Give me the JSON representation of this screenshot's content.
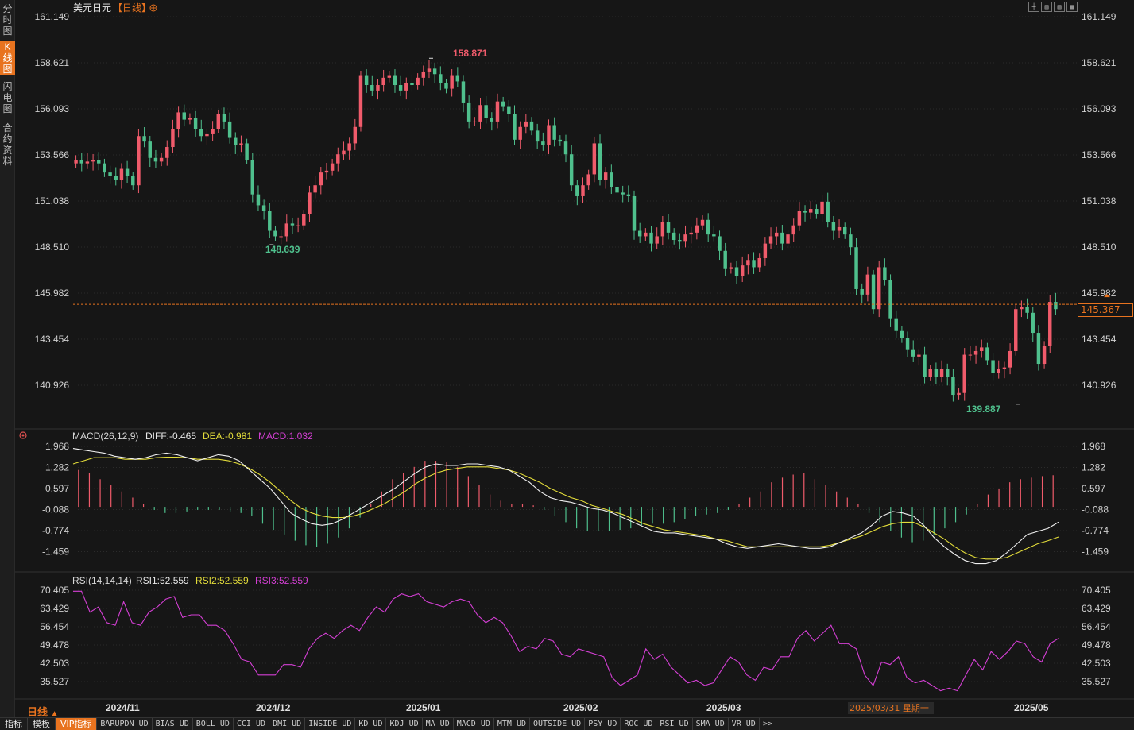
{
  "sidebar": {
    "tabs": [
      "分时图",
      "K线图",
      "闪电图",
      "合约资料"
    ],
    "active": 1
  },
  "header": {
    "symbol": "美元日元",
    "period_tag": "【日线】",
    "add_icon": "plus-circle-icon"
  },
  "toolbar": {
    "icons": [
      "crosshair-icon",
      "bar-chart-icon",
      "candle-chart-icon",
      "layout-icon"
    ]
  },
  "colors": {
    "up": "#f05b6b",
    "down": "#4fc08d",
    "accent": "#e8731f",
    "grid": "#2b2b2b",
    "diff": "#f0f0f0",
    "dea": "#e3dc3a",
    "rsi": "#d43fd4"
  },
  "price_panel": {
    "ticks": [
      "161.149",
      "158.621",
      "156.093",
      "153.566",
      "151.038",
      "148.510",
      "145.982",
      "143.454",
      "140.926"
    ],
    "current": "145.367",
    "annotations": {
      "high": "158.871",
      "low_1": "148.639",
      "low_2": "139.887"
    }
  },
  "macd_panel": {
    "label": "MACD(26,12,9)",
    "diff": "DIFF:-0.465",
    "dea": "DEA:-0.981",
    "macd": "MACD:1.032",
    "ticks": [
      "1.968",
      "1.282",
      "0.597",
      "-0.088",
      "-0.774",
      "-1.459"
    ]
  },
  "rsi_panel": {
    "label": "RSI(14,14,14)",
    "rsi1": "RSI1:52.559",
    "rsi2": "RSI2:52.559",
    "rsi3": "RSI3:52.559",
    "ticks": [
      "70.405",
      "63.429",
      "56.454",
      "49.478",
      "42.503",
      "35.527"
    ]
  },
  "x_axis": {
    "labels": [
      "2024/11",
      "2024/12",
      "2025/01",
      "2025/02",
      "2025/03",
      "2025/05"
    ]
  },
  "crosshair": {
    "date": "2025/03/31",
    "weekday": "星期一"
  },
  "period": "日线",
  "bottom_bar": {
    "tabs": [
      "指标",
      "模板"
    ],
    "vip": "VIP指标",
    "indicators": [
      "BARUPDN_UD",
      "BIAS_UD",
      "BOLL_UD",
      "CCI_UD",
      "DMI_UD",
      "INSIDE_UD",
      "KD_UD",
      "KDJ_UD",
      "MA_UD",
      "MACD_UD",
      "MTM_UD",
      "OUTSIDE_UD",
      "PSY_UD",
      "ROC_UD",
      "RSI_UD",
      "SMA_UD",
      "VR_UD"
    ],
    "more": ">>"
  },
  "chart_data": {
    "type": "candlestick",
    "title": "美元日元",
    "period": "daily",
    "x_labels": [
      "2024/11",
      "2024/12",
      "2025/01",
      "2025/02",
      "2025/03",
      "2025/05"
    ],
    "ylim": [
      139.4,
      161.149
    ],
    "current_price": 145.367,
    "high": 158.871,
    "low": 139.887,
    "closes": [
      153.3,
      153.1,
      153.2,
      153.3,
      153.1,
      152.6,
      152.4,
      152.2,
      152.8,
      152.4,
      151.9,
      154.6,
      154.3,
      153.4,
      153.2,
      153.4,
      154.0,
      155.0,
      155.9,
      155.5,
      155.6,
      155.0,
      154.6,
      154.7,
      155.0,
      155.8,
      155.4,
      154.5,
      154.1,
      154.2,
      153.3,
      151.4,
      150.8,
      150.5,
      149.4,
      149.1,
      149.1,
      149.8,
      149.7,
      149.7,
      150.3,
      151.5,
      151.9,
      152.6,
      152.7,
      153.1,
      153.6,
      153.8,
      154.2,
      155.1,
      157.9,
      157.4,
      157.1,
      157.4,
      157.8,
      157.9,
      157.4,
      157.1,
      157.5,
      157.4,
      157.8,
      158.1,
      158.3,
      158.0,
      157.5,
      157.2,
      157.9,
      157.6,
      156.4,
      155.4,
      155.4,
      156.3,
      155.6,
      155.4,
      156.5,
      156.2,
      155.8,
      154.4,
      155.1,
      155.4,
      154.9,
      154.3,
      154.1,
      155.2,
      154.4,
      154.3,
      153.6,
      151.9,
      151.3,
      151.9,
      152.5,
      154.2,
      152.2,
      152.6,
      151.8,
      151.5,
      151.4,
      151.3,
      149.4,
      149.1,
      149.3,
      148.7,
      149.1,
      149.9,
      149.3,
      148.9,
      148.8,
      149.2,
      149.3,
      149.7,
      150.0,
      149.2,
      149.1,
      148.3,
      147.3,
      147.4,
      146.9,
      147.5,
      147.8,
      147.4,
      147.9,
      148.7,
      149.1,
      149.3,
      148.7,
      149.2,
      149.7,
      150.5,
      150.4,
      150.6,
      150.3,
      151.0,
      149.9,
      149.4,
      149.6,
      149.2,
      148.5,
      146.2,
      145.9,
      147.0,
      145.1,
      147.4,
      146.7,
      144.6,
      143.9,
      143.5,
      142.9,
      142.5,
      142.6,
      141.4,
      141.8,
      141.4,
      141.8,
      141.4,
      140.4,
      140.5,
      142.6,
      142.6,
      142.8,
      143.0,
      142.3,
      141.6,
      141.8,
      141.9,
      142.8,
      145.1,
      145.2,
      144.9,
      143.8,
      142.1,
      143.1,
      145.5,
      145.1
    ],
    "series": [
      {
        "name": "DIFF",
        "values": [
          1.9,
          1.85,
          1.8,
          1.75,
          1.65,
          1.6,
          1.55,
          1.6,
          1.7,
          1.75,
          1.7,
          1.6,
          1.5,
          1.6,
          1.7,
          1.65,
          1.5,
          1.2,
          0.9,
          0.6,
          0.2,
          -0.2,
          -0.4,
          -0.55,
          -0.6,
          -0.55,
          -0.4,
          -0.2,
          0.0,
          0.2,
          0.4,
          0.6,
          0.85,
          1.1,
          1.3,
          1.4,
          1.35,
          1.35,
          1.4,
          1.4,
          1.35,
          1.3,
          1.2,
          1.0,
          0.8,
          0.5,
          0.3,
          0.2,
          0.15,
          0.05,
          -0.05,
          -0.1,
          -0.2,
          -0.35,
          -0.5,
          -0.65,
          -0.8,
          -0.85,
          -0.85,
          -0.9,
          -0.95,
          -1.0,
          -1.05,
          -1.2,
          -1.3,
          -1.35,
          -1.3,
          -1.25,
          -1.2,
          -1.25,
          -1.3,
          -1.35,
          -1.35,
          -1.3,
          -1.15,
          -1.0,
          -0.85,
          -0.6,
          -0.3,
          -0.15,
          -0.2,
          -0.3,
          -0.6,
          -1.0,
          -1.3,
          -1.55,
          -1.75,
          -1.85,
          -1.85,
          -1.75,
          -1.5,
          -1.2,
          -0.9,
          -0.8,
          -0.7,
          -0.5
        ]
      },
      {
        "name": "DEA",
        "values": [
          1.4,
          1.5,
          1.6,
          1.6,
          1.6,
          1.55,
          1.55,
          1.55,
          1.6,
          1.62,
          1.62,
          1.6,
          1.55,
          1.55,
          1.55,
          1.5,
          1.4,
          1.25,
          1.05,
          0.8,
          0.5,
          0.2,
          -0.05,
          -0.2,
          -0.3,
          -0.35,
          -0.35,
          -0.3,
          -0.2,
          -0.05,
          0.1,
          0.3,
          0.5,
          0.75,
          0.95,
          1.1,
          1.2,
          1.25,
          1.3,
          1.3,
          1.3,
          1.25,
          1.2,
          1.1,
          0.95,
          0.8,
          0.6,
          0.45,
          0.3,
          0.2,
          0.05,
          -0.05,
          -0.15,
          -0.25,
          -0.4,
          -0.55,
          -0.65,
          -0.75,
          -0.8,
          -0.85,
          -0.9,
          -0.95,
          -1.05,
          -1.1,
          -1.2,
          -1.3,
          -1.3,
          -1.3,
          -1.3,
          -1.3,
          -1.3,
          -1.3,
          -1.3,
          -1.25,
          -1.15,
          -1.05,
          -0.95,
          -0.8,
          -0.65,
          -0.55,
          -0.5,
          -0.5,
          -0.65,
          -0.85,
          -1.05,
          -1.3,
          -1.5,
          -1.65,
          -1.7,
          -1.7,
          -1.65,
          -1.5,
          -1.35,
          -1.2,
          -1.1,
          -0.98
        ]
      },
      {
        "name": "MACD",
        "values": [
          1.2,
          1.1,
          0.9,
          0.7,
          0.5,
          0.3,
          0.1,
          -0.1,
          -0.2,
          -0.2,
          -0.15,
          -0.1,
          -0.1,
          -0.1,
          -0.15,
          -0.2,
          -0.3,
          -0.55,
          -0.75,
          -0.9,
          -1.1,
          -1.25,
          -1.3,
          -1.2,
          -1.0,
          -0.7,
          -0.35,
          0.1,
          0.5,
          0.9,
          1.1,
          1.3,
          1.5,
          1.5,
          1.45,
          1.3,
          1.0,
          0.7,
          0.4,
          0.2,
          0.1,
          0.1,
          0.05,
          -0.1,
          -0.3,
          -0.5,
          -0.7,
          -0.8,
          -0.8,
          -0.8,
          -0.75,
          -0.7,
          -0.6,
          -0.55,
          -0.55,
          -0.5,
          -0.4,
          -0.3,
          -0.25,
          -0.2,
          -0.1,
          0.1,
          0.3,
          0.5,
          0.8,
          0.95,
          1.05,
          1.1,
          0.9,
          0.7,
          0.5,
          0.3,
          0.1,
          -0.2,
          -0.5,
          -0.8,
          -1.0,
          -1.15,
          -1.1,
          -0.9,
          -0.7,
          -0.5,
          -0.25,
          0.1,
          0.4,
          0.6,
          0.8,
          0.9,
          0.95,
          1.0,
          1.03
        ]
      },
      {
        "name": "RSI",
        "values": [
          70,
          70,
          62,
          64,
          58,
          57,
          66,
          58,
          57,
          62,
          64,
          67,
          68,
          60,
          61,
          61,
          57,
          57,
          55,
          50,
          44,
          43,
          38,
          38,
          38,
          42,
          42,
          41,
          48,
          52,
          54,
          52,
          55,
          57,
          55,
          60,
          64,
          62,
          67,
          69,
          68,
          69,
          66,
          65,
          64,
          66,
          67,
          66,
          61,
          58,
          60,
          58,
          53,
          47,
          49,
          48,
          52,
          51,
          46,
          45,
          48,
          47,
          46,
          45,
          37,
          34,
          36,
          38,
          48,
          44,
          46,
          41,
          38,
          35,
          36,
          34,
          35,
          40,
          45,
          43,
          38,
          36,
          41,
          40,
          45,
          45,
          52,
          55,
          51,
          54,
          57,
          50,
          50,
          48,
          38,
          34,
          43,
          42,
          45,
          37,
          35,
          36,
          34,
          32,
          33,
          32,
          38,
          44,
          40,
          47,
          44,
          47,
          51,
          50,
          45,
          43,
          50,
          52
        ]
      }
    ]
  }
}
